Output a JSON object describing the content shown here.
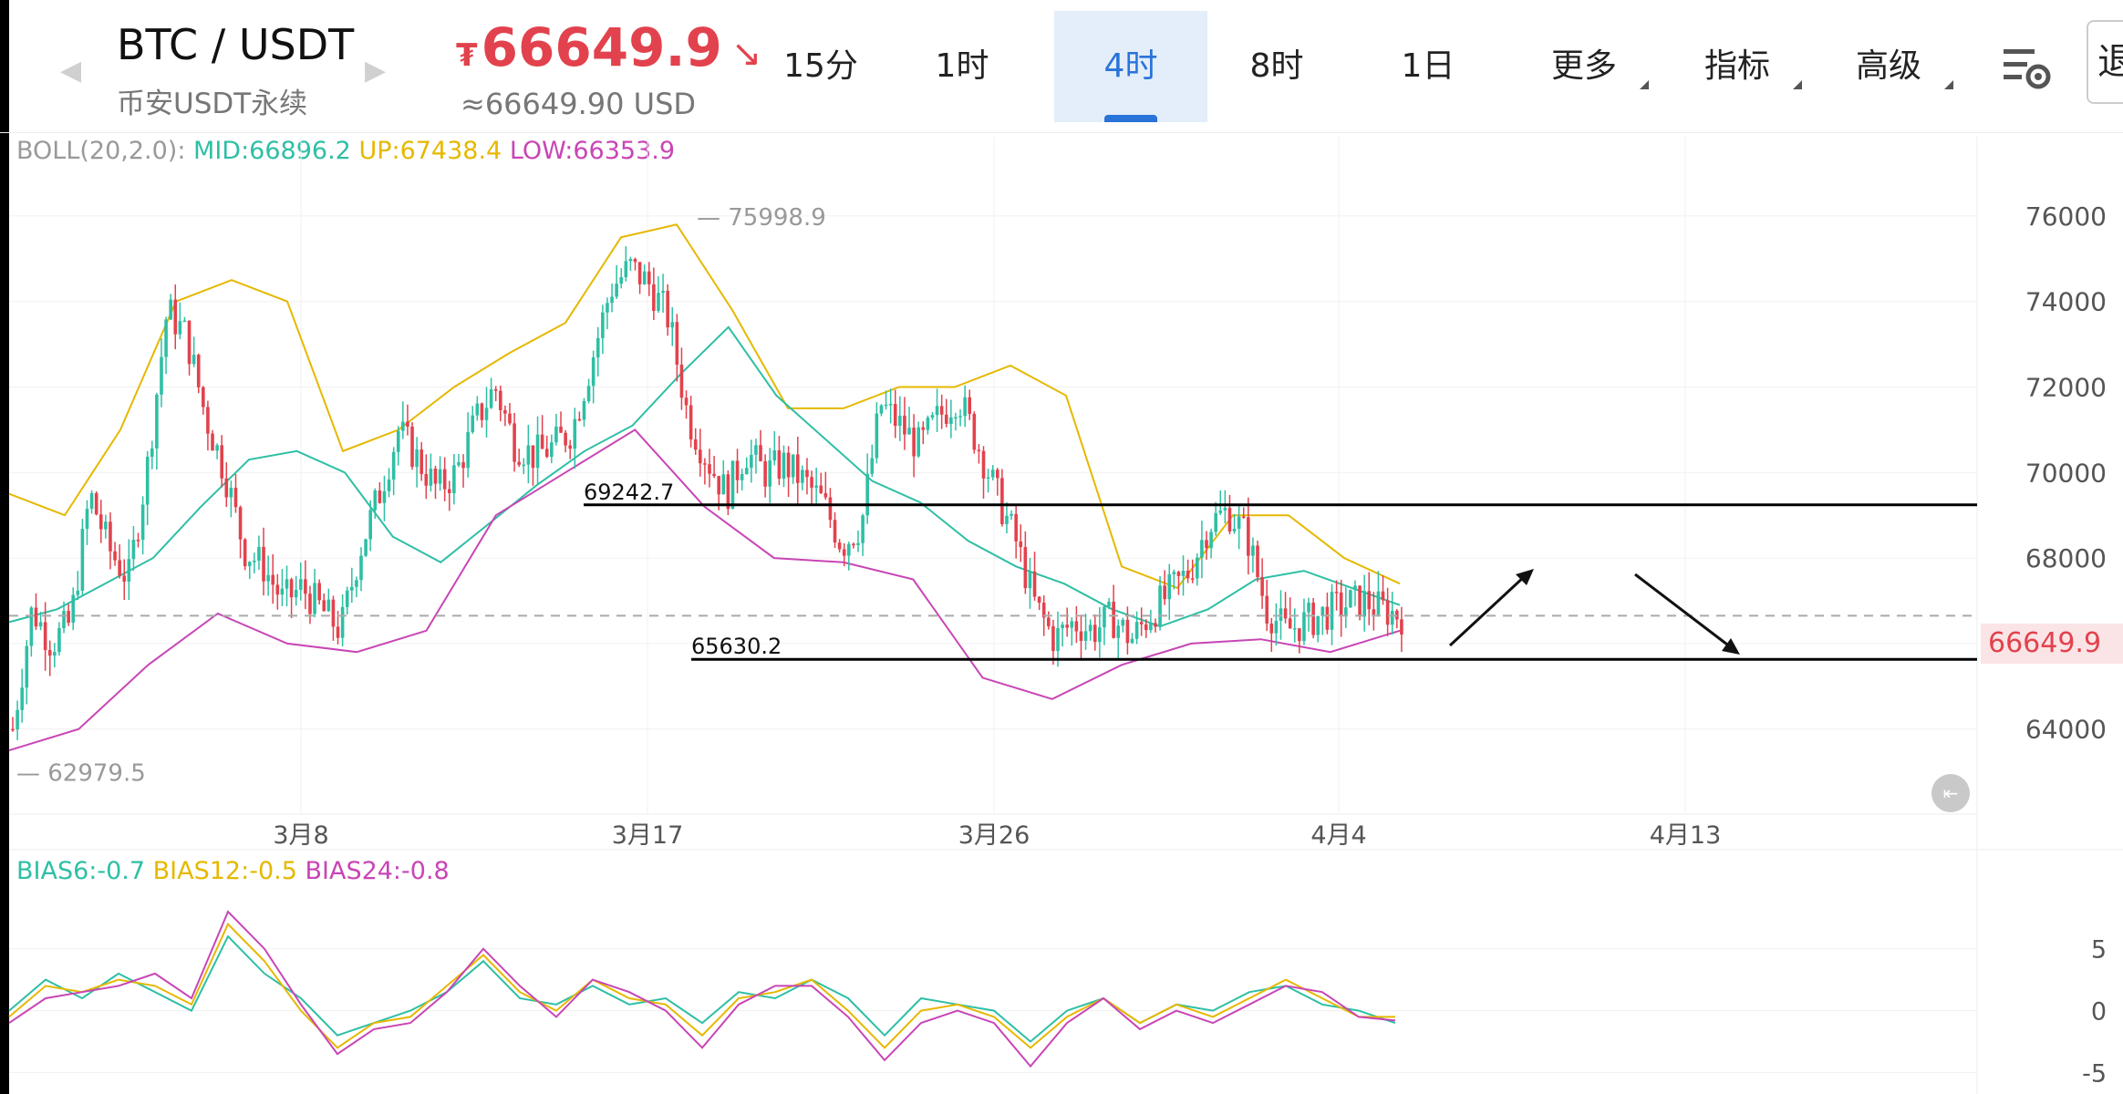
{
  "header": {
    "pair": "BTC / USDT",
    "subtitle": "币安USDT永续",
    "currency_symbol": "₮",
    "price": "66649.9",
    "price_usd": "≈66649.90 USD",
    "trend_icon": "down-right-arrow-icon",
    "price_color": "#e2424d",
    "tabs": [
      {
        "label": "15分",
        "active": false
      },
      {
        "label": "1时",
        "active": false
      },
      {
        "label": "4时",
        "active": true
      },
      {
        "label": "8时",
        "active": false
      },
      {
        "label": "1日",
        "active": false
      },
      {
        "label": "更多",
        "active": false,
        "dropdown": true
      },
      {
        "label": "指标",
        "active": false,
        "dropdown": true
      },
      {
        "label": "高级",
        "active": false,
        "dropdown": true
      }
    ],
    "settings_icon": "chart-settings-icon",
    "edge_label": "退"
  },
  "boll": {
    "label": "BOLL(20,2.0):",
    "mid": "MID:66896.2",
    "up": "UP:67438.4",
    "low": "LOW:66353.9"
  },
  "bias": {
    "b6": "BIAS6:-0.7",
    "b12": "BIAS12:-0.5",
    "b24": "BIAS24:-0.8"
  },
  "colors": {
    "up": "#2ebfa5",
    "down": "#e2424d",
    "mid": "#2ebfa5",
    "upper": "#e6b800",
    "lower": "#c845b6",
    "accent": "#2a73d9"
  },
  "chart_data": [
    {
      "type": "candlestick",
      "title": "",
      "x_ticks": [
        "3月8",
        "3月17",
        "3月26",
        "4月4",
        "4月13"
      ],
      "y_ticks": [
        64000,
        66000,
        68000,
        70000,
        72000,
        74000,
        76000
      ],
      "ylim": [
        62500,
        77000
      ],
      "high_label": "75998.9",
      "low_label": "62979.5",
      "current_price_label": "66649.9",
      "current_price": 66649.9,
      "levels": [
        {
          "label": "69242.7",
          "value": 69242.7
        },
        {
          "label": "65630.2",
          "value": 65630.2
        }
      ],
      "annotations": [
        "up-arrow",
        "down-arrow"
      ],
      "close_path": [
        64000,
        66800,
        66000,
        66500,
        69500,
        68200,
        67500,
        70200,
        73800,
        73200,
        71300,
        70000,
        68200,
        67800,
        67000,
        67300,
        66800,
        66300,
        68200,
        69500,
        71000,
        70300,
        69600,
        70000,
        71200,
        72000,
        70700,
        70400,
        70600,
        71000,
        72600,
        74300,
        74800,
        74400,
        73600,
        71300,
        70300,
        69500,
        70500,
        70000,
        70200,
        69800,
        69300,
        68300,
        68800,
        71600,
        71100,
        70600,
        71300,
        71800,
        70700,
        69500,
        68400,
        66900,
        66100,
        66500,
        66300,
        66600,
        66100,
        66700,
        67200,
        67700,
        68800,
        69100,
        68500,
        66800,
        66300,
        66500,
        66700,
        66900,
        67000,
        66800,
        66649.9
      ],
      "mid_band": [
        66500,
        66800,
        67400,
        68000,
        69200,
        70300,
        70500,
        70000,
        68500,
        67900,
        68800,
        69700,
        70500,
        71100,
        72300,
        73400,
        71800,
        70800,
        69800,
        69300,
        68400,
        67800,
        67400,
        66800,
        66400,
        66800,
        67500,
        67700,
        67300,
        66900
      ],
      "upper_band": [
        69500,
        69000,
        71000,
        74000,
        74500,
        74000,
        70500,
        71000,
        72000,
        72800,
        73500,
        75500,
        75800,
        73800,
        71500,
        71500,
        72000,
        72000,
        72500,
        71800,
        67800,
        67300,
        69000,
        69000,
        68000,
        67400
      ],
      "lower_band": [
        63500,
        64000,
        65500,
        66700,
        66000,
        65800,
        66300,
        69000,
        70000,
        71000,
        69200,
        68000,
        67900,
        67500,
        65200,
        64700,
        65500,
        66000,
        66100,
        65800,
        66300
      ]
    },
    {
      "type": "line",
      "title": "",
      "y_ticks": [
        5,
        0,
        -5
      ],
      "ylim": [
        -6,
        8
      ],
      "series": [
        {
          "name": "BIAS6",
          "color": "#2ebfa5",
          "values": [
            0,
            2.5,
            1,
            3,
            1.5,
            0,
            6,
            3,
            1,
            -2,
            -1,
            0,
            1.5,
            4,
            1,
            0.5,
            2,
            0.5,
            1,
            -1,
            1.5,
            1,
            2.5,
            1,
            -2,
            1,
            0.5,
            0,
            -2.5,
            0,
            1,
            -1,
            0.5,
            0,
            1.5,
            2,
            0.5,
            0,
            -1
          ]
        },
        {
          "name": "BIAS12",
          "color": "#e6b800",
          "values": [
            -0.5,
            2,
            1.5,
            2.5,
            2,
            0.5,
            7,
            4,
            0,
            -3,
            -1,
            -0.5,
            2,
            4.5,
            1.5,
            0,
            2.5,
            1,
            0.5,
            -2,
            1,
            1.5,
            2.5,
            0,
            -3,
            0,
            0.5,
            -0.5,
            -3,
            -0.5,
            1,
            -1,
            0.5,
            -0.5,
            1,
            2.5,
            1,
            -0.5,
            -0.5
          ]
        },
        {
          "name": "BIAS24",
          "color": "#c845b6",
          "values": [
            -1,
            1,
            1.5,
            2,
            3,
            1,
            8,
            5,
            0.5,
            -3.5,
            -1.5,
            -1,
            1.5,
            5,
            2,
            -0.5,
            2.5,
            1.5,
            0,
            -3,
            0.5,
            2,
            2,
            -0.5,
            -4,
            -1,
            0,
            -1,
            -4.5,
            -1,
            1,
            -1.5,
            0,
            -1,
            0.5,
            2,
            1.5,
            -0.5,
            -0.8
          ]
        }
      ]
    }
  ]
}
